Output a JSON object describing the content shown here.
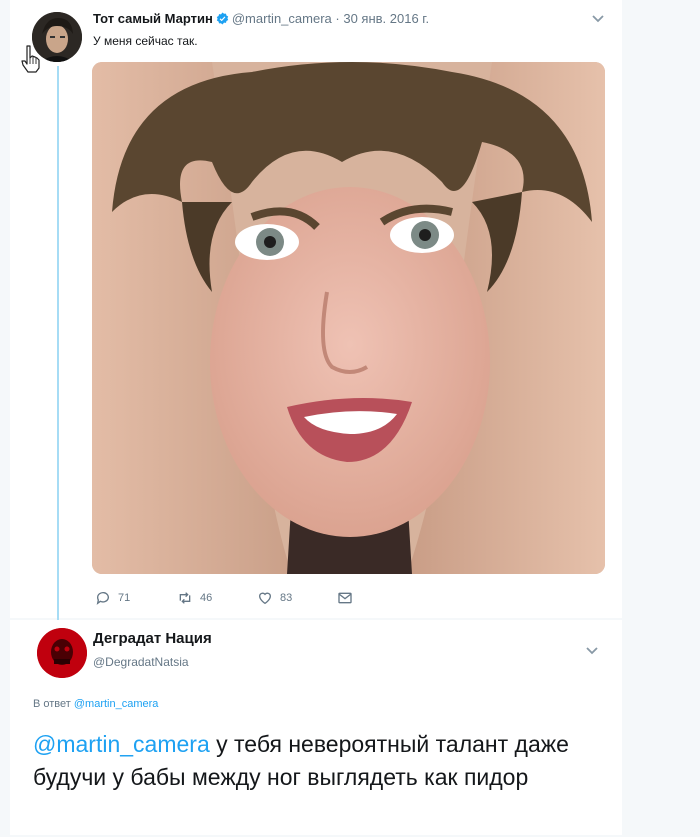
{
  "tweet1": {
    "author_name": "Тот самый Мартин",
    "handle": "@martin_camera",
    "separator": "·",
    "date": "30 янв. 2016 г.",
    "text": "У меня сейчас так.",
    "avatar_icon": "user-avatar",
    "verified_icon": "verified-badge-icon",
    "actions": {
      "reply_count": "71",
      "retweet_count": "46",
      "like_count": "83"
    }
  },
  "tweet2": {
    "author_name": "Деградат Нация",
    "handle": "@DegradatNatsia",
    "reply_prefix": "В ответ",
    "reply_to": "@martin_camera",
    "mention": "@martin_camera",
    "text": " у тебя невероятный талант даже будучи у бабы между ног выглядеть как пидор"
  },
  "colors": {
    "accent": "#1da1f2",
    "thread_line": "#a6dcf5",
    "secondary_text": "#657786",
    "avatar2_bg": "#c0000e"
  }
}
